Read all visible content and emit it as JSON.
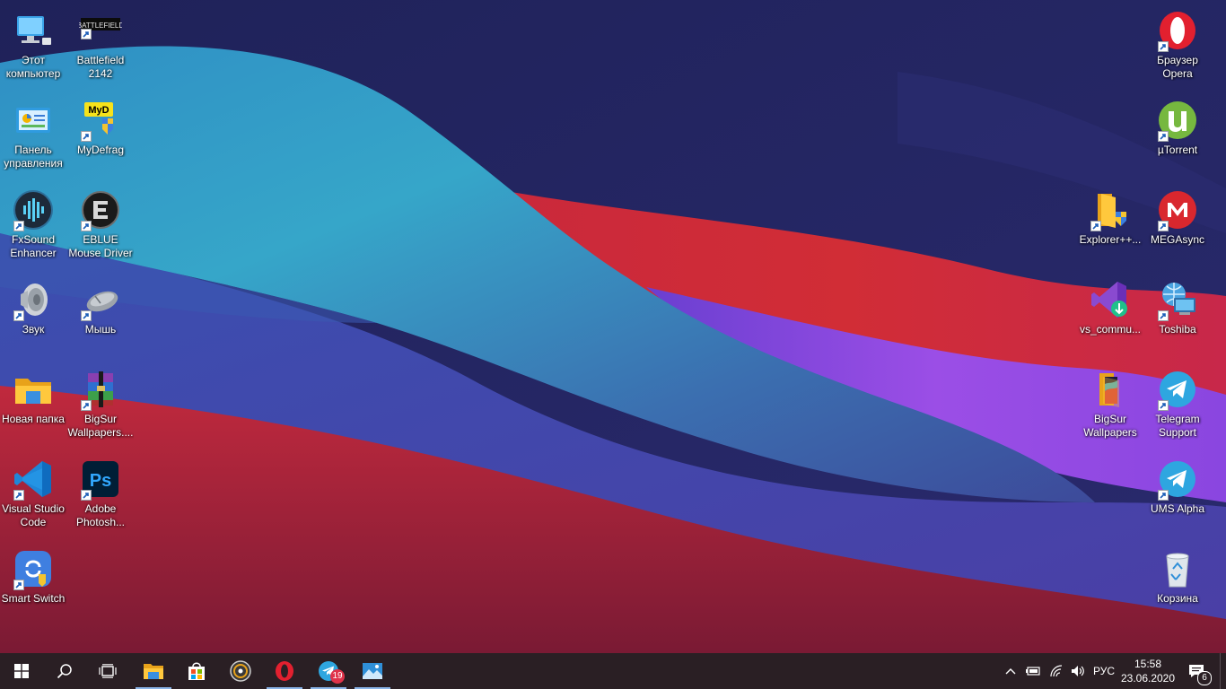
{
  "desktop_icons": {
    "this_pc": "Этот\nкомпьютер",
    "battlefield": "Battlefield\n2142",
    "battlefield_logo": "BATTLEFIELD",
    "control_panel": "Панель\nуправления",
    "mydefrag": "MyDefrag",
    "mydefrag_logo": "MyD",
    "fxsound": "FxSound\nEnhancer",
    "eblue": "EBLUE\nMouse Driver",
    "sound": "Звук",
    "mouse": "Мышь",
    "new_folder": "Новая папка",
    "bigsur_rar": "BigSur\nWallpapers....",
    "vscode": "Visual Studio\nCode",
    "photoshop": "Adobe\nPhotosh...",
    "photoshop_logo": "Ps",
    "smart_switch": "Smart Switch",
    "opera": "Браузер\nOpera",
    "utorrent": "µTorrent",
    "explorerpp": "Explorer++...",
    "megasync": "MEGAsync",
    "vs_community": "vs_commu...",
    "toshiba": "Toshiba",
    "bigsur_folder": "BigSur\nWallpapers",
    "telegram_support": "Telegram\nSupport",
    "ums_alpha": "UMS Alpha",
    "recycle_bin": "Корзина"
  },
  "taskbar": {
    "telegram_badge": "19",
    "language": "РУС",
    "time": "15:58",
    "date": "23.06.2020",
    "notification_count": "6"
  },
  "colors": {
    "taskbar_bg": "#2a1f24",
    "accent": "#8ab4e8",
    "badge": "#e0334a"
  },
  "icons": [
    "windows-start-icon",
    "search-icon",
    "task-view-icon",
    "file-explorer-icon",
    "store-icon",
    "media-player-icon",
    "opera-icon",
    "telegram-icon",
    "photos-icon",
    "chevron-up-icon",
    "battery-icon",
    "wifi-icon",
    "volume-icon",
    "notification-icon"
  ]
}
